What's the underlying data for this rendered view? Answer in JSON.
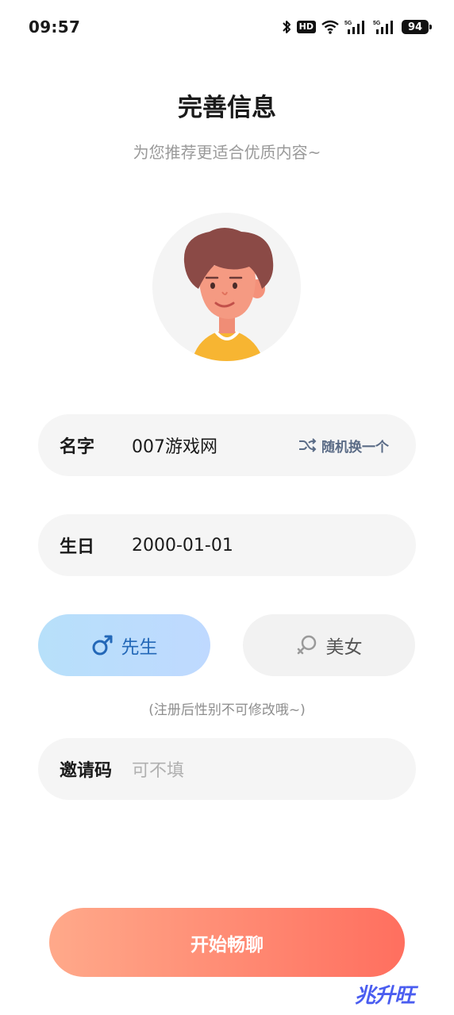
{
  "status_bar": {
    "time": "09:57",
    "hd": "HD",
    "battery": "94"
  },
  "header": {
    "title": "完善信息",
    "subtitle": "为您推荐更适合优质内容~"
  },
  "form": {
    "name": {
      "label": "名字",
      "value": "007游戏网",
      "random_label": "随机换一个"
    },
    "birthday": {
      "label": "生日",
      "value": "2000-01-01"
    },
    "gender": {
      "male_label": "先生",
      "female_label": "美女",
      "selected": "male",
      "note": "(注册后性别不可修改哦~)"
    },
    "invite": {
      "label": "邀请码",
      "placeholder": "可不填"
    }
  },
  "actions": {
    "start_label": "开始畅聊"
  },
  "watermark": {
    "text": "兆升旺"
  },
  "colors": {
    "primary_gradient_start": "#ffa98a",
    "primary_gradient_end": "#ff6f5f",
    "male_active": "#2368b8"
  }
}
